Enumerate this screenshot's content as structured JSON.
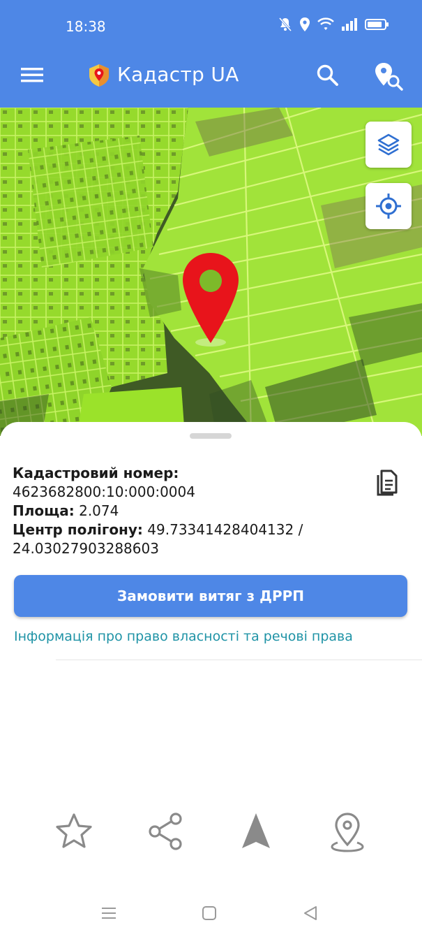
{
  "status_bar": {
    "time": "18:38"
  },
  "app_bar": {
    "title": "Кадастр UA"
  },
  "parcel": {
    "cadastral_label": "Кадастровий номер:",
    "cadastral_number": "4623682800:10:000:0004",
    "area_label": "Площа:",
    "area_value": "2.074",
    "center_label": "Центр полігону:",
    "center_lat": "49.73341428404132",
    "center_separator": "/",
    "center_lon": "24.03027903288603"
  },
  "actions": {
    "order_button": "Замовити витяг з ДРРП",
    "ownership_link": "Інформація про право власності та речові права"
  },
  "icons": {
    "menu": "menu-icon",
    "logo": "app-logo-icon",
    "search": "search-icon",
    "pin_search": "pin-search-icon",
    "layers": "layers-icon",
    "locate": "my-location-icon",
    "marker": "map-marker-icon",
    "document": "document-icon",
    "favorite": "star-icon",
    "share": "share-icon",
    "navigate": "navigation-arrow-icon",
    "place": "place-icon"
  },
  "colors": {
    "accent": "#4e87e6",
    "link": "#1f93a6",
    "parcel_fill": "#9be22a",
    "marker": "#e8141b"
  }
}
